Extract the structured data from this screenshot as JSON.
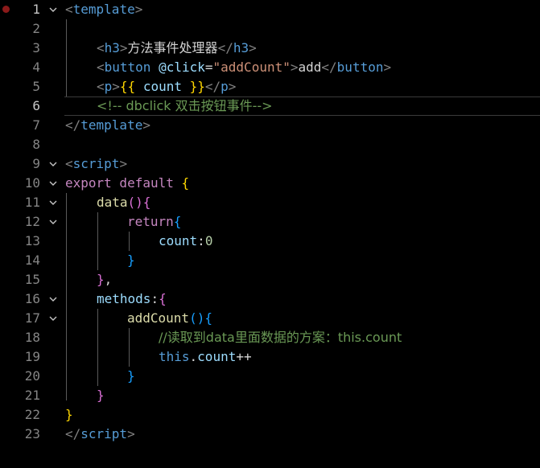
{
  "colors": {
    "background": "#000000",
    "line_number": "#858585",
    "active_line_number": "#c6c6c6",
    "breakpoint": "#8b1a1a",
    "tag": "#569cd6",
    "tag_punct": "#808080",
    "attribute": "#9cdcfe",
    "string": "#ce9178",
    "comment": "#6a9955",
    "keyword_control": "#c586c0",
    "function": "#dcdcaa",
    "number": "#b5cea8"
  },
  "editor": {
    "active_line": 6,
    "line_numbers": [
      "1",
      "2",
      "3",
      "4",
      "5",
      "6",
      "7",
      "8",
      "9",
      "10",
      "11",
      "12",
      "13",
      "14",
      "15",
      "16",
      "17",
      "18",
      "19",
      "20",
      "21",
      "22",
      "23"
    ],
    "lines": {
      "l1": {
        "open": "<",
        "tag": "template",
        "close": ">"
      },
      "l3": {
        "open": "<",
        "tag": "h3",
        "close": ">",
        "text": "方法事件处理器",
        "end_open": "</",
        "end_tag": "h3",
        "end_close": ">"
      },
      "l4": {
        "open": "<",
        "tag": "button",
        "space": " ",
        "attr": "@click",
        "eq": "=",
        "quote1": "\"",
        "val": "addCount",
        "quote2": "\"",
        "close": ">",
        "text": "add",
        "end_open": "</",
        "end_tag": "button",
        "end_close": ">"
      },
      "l5": {
        "open": "<",
        "tag": "p",
        "close": ">",
        "mus_open": "{{",
        "var": " count ",
        "mus_close": "}}",
        "end_open": "</",
        "end_tag": "p",
        "end_close": ">"
      },
      "l6": {
        "comment": "<!-- dbclick 双击按钮事件-->"
      },
      "l7": {
        "end_open": "</",
        "tag": "template",
        "close": ">"
      },
      "l9": {
        "open": "<",
        "tag": "script",
        "close": ">"
      },
      "l10": {
        "kw1": "export",
        "kw2": " default",
        "brace": " {"
      },
      "l11": {
        "fn": "data",
        "paren": "()",
        "brace": "{"
      },
      "l12": {
        "kw": "return",
        "brace": "{"
      },
      "l13": {
        "prop": "count",
        "colon": ":",
        "num": "0"
      },
      "l14": {
        "brace": "}"
      },
      "l15": {
        "brace": "}",
        "comma": ","
      },
      "l16": {
        "prop": "methods",
        "colon": ":",
        "brace": "{"
      },
      "l17": {
        "fn": "addCount",
        "paren": "()",
        "brace": "{"
      },
      "l18": {
        "comment": "//读取到data里面数据的方案：this.count"
      },
      "l19": {
        "this": "this",
        "dot": ".",
        "prop": "count",
        "op": "++"
      },
      "l20": {
        "brace": "}"
      },
      "l21": {
        "brace": "}"
      },
      "l22": {
        "brace": "}"
      },
      "l23": {
        "end_open": "</",
        "tag": "script",
        "close": ">"
      }
    }
  }
}
